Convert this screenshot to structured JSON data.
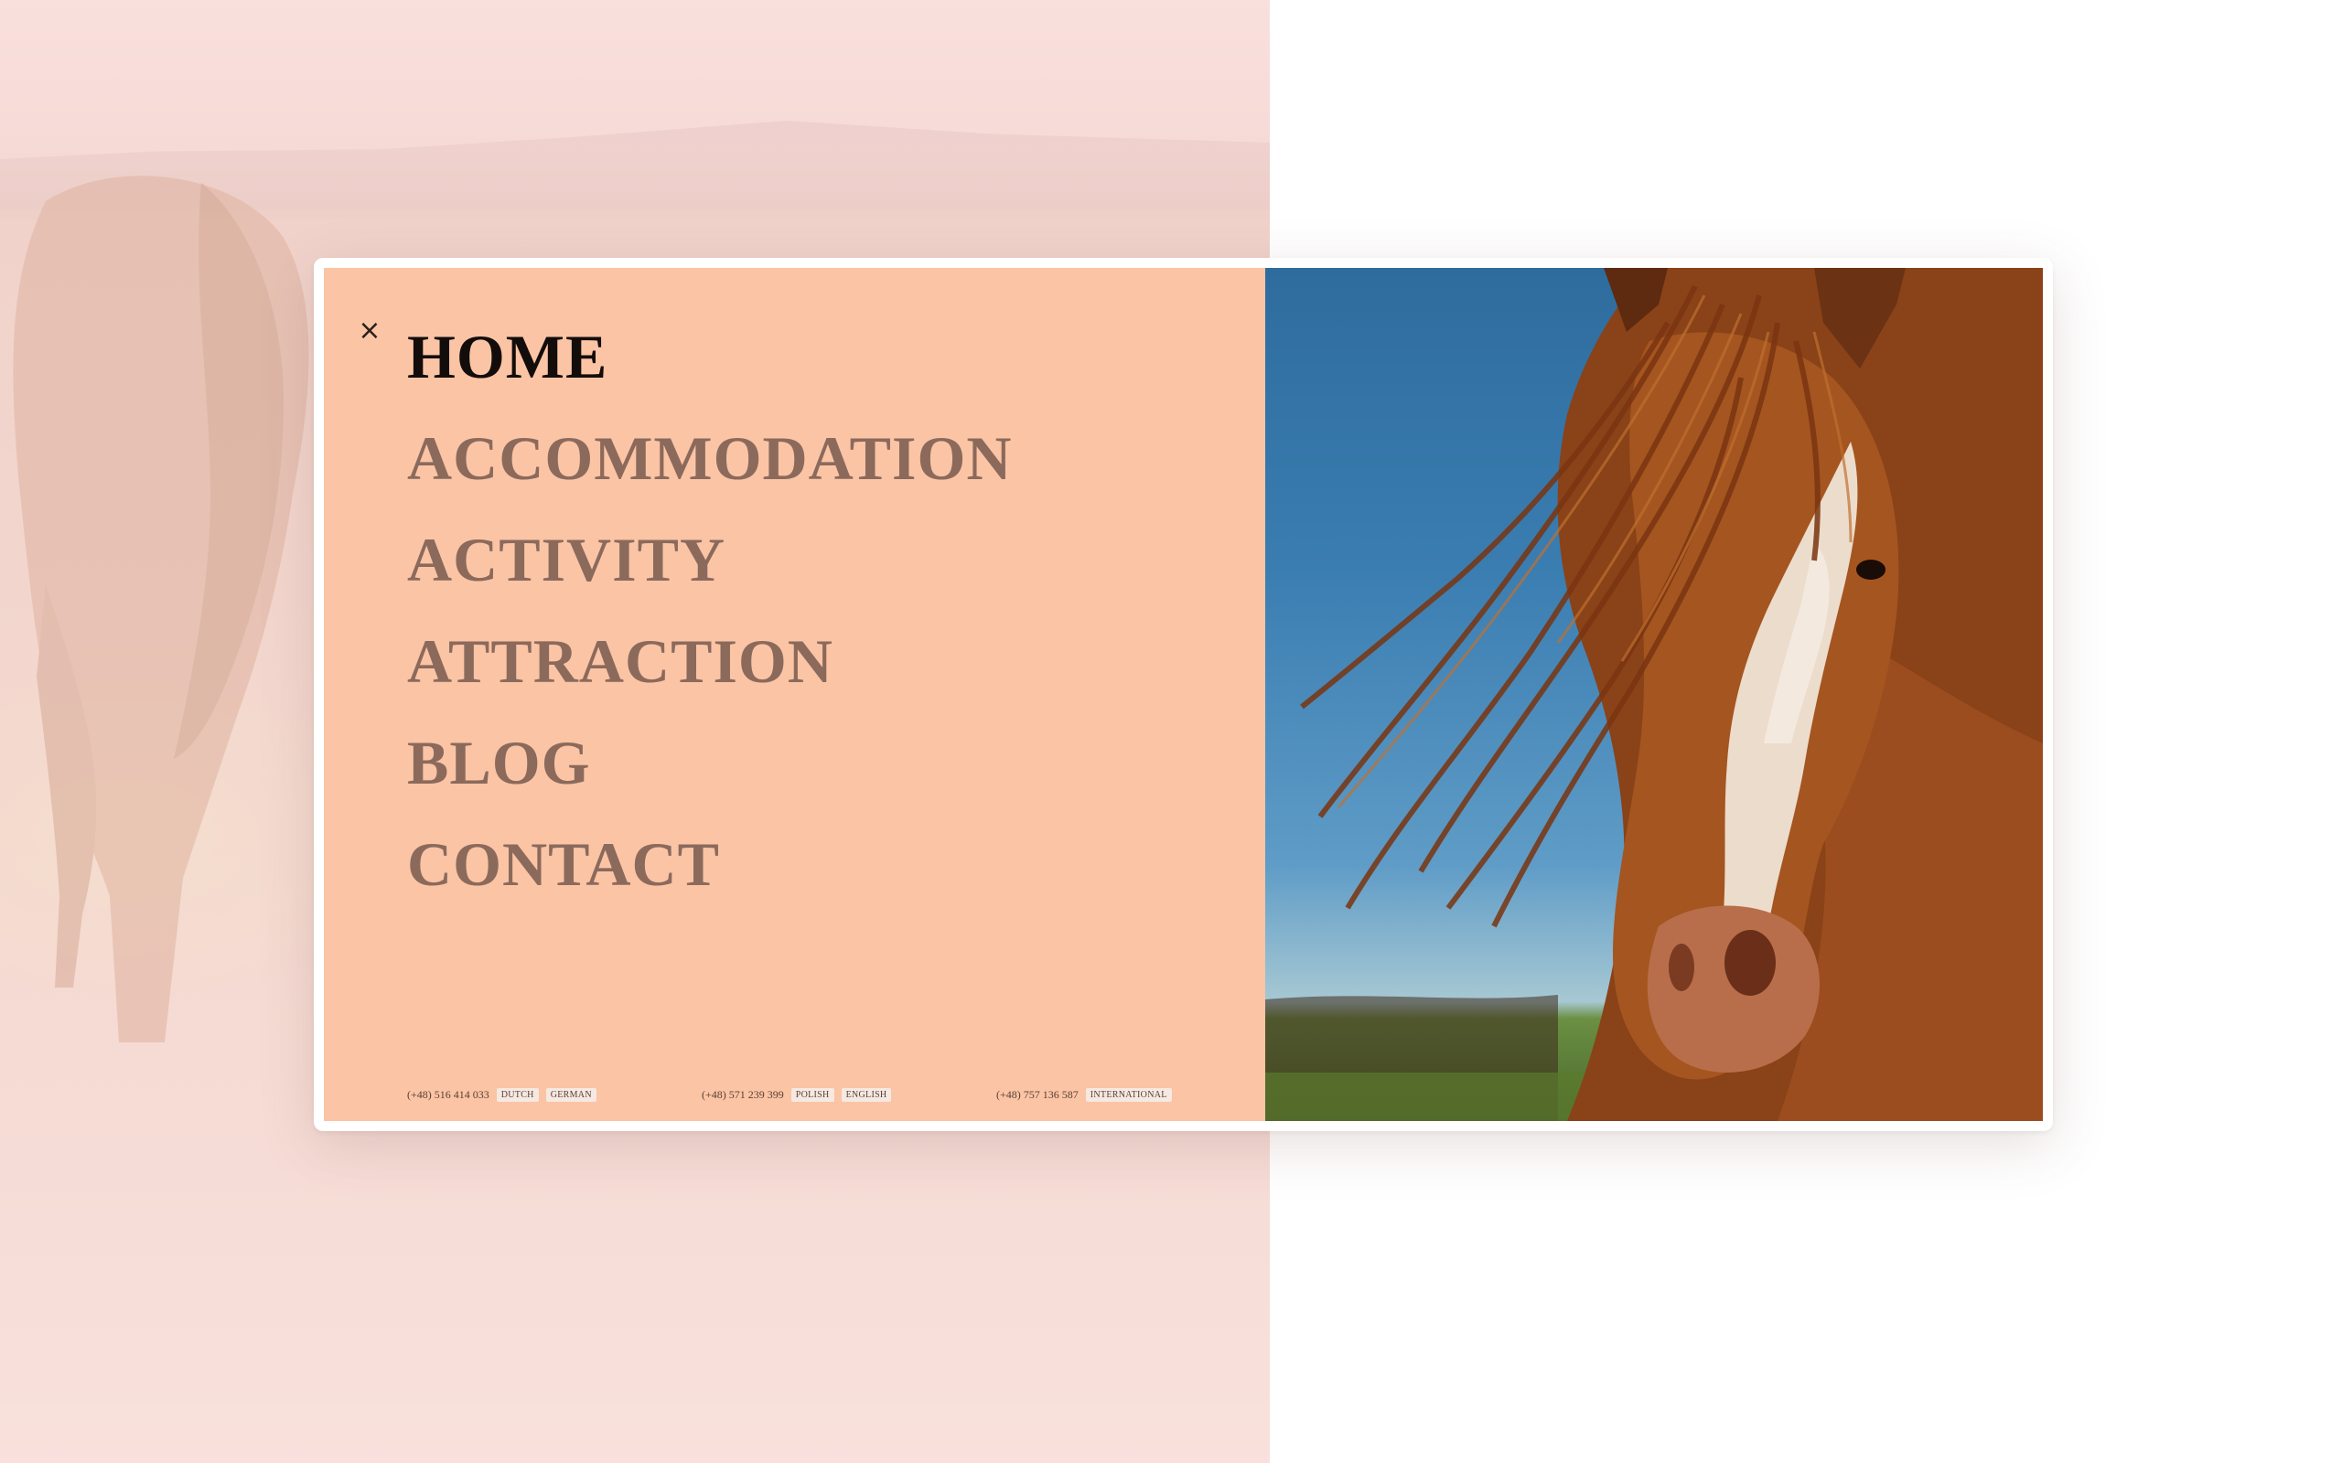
{
  "menu": {
    "close_icon": "close-icon",
    "items": [
      {
        "label": "HOME",
        "active": true
      },
      {
        "label": "ACCOMMODATION",
        "active": false
      },
      {
        "label": "ACTIVITY",
        "active": false
      },
      {
        "label": "ATTRACTION",
        "active": false
      },
      {
        "label": "BLOG",
        "active": false
      },
      {
        "label": "CONTACT",
        "active": false
      }
    ]
  },
  "contacts": [
    {
      "phone": "(+48) 516 414 033",
      "languages": [
        "DUTCH",
        "GERMAN"
      ]
    },
    {
      "phone": "(+48) 571 239 399",
      "languages": [
        "POLISH",
        "ENGLISH"
      ]
    },
    {
      "phone": "(+48) 757 136 587",
      "languages": [
        "INTERNATIONAL"
      ]
    }
  ],
  "colors": {
    "menu_panel": "#fbc4a5",
    "active_item": "#120d0b",
    "inactive_item": "#8b6a5c",
    "background_tint": "#f8dcd9"
  }
}
